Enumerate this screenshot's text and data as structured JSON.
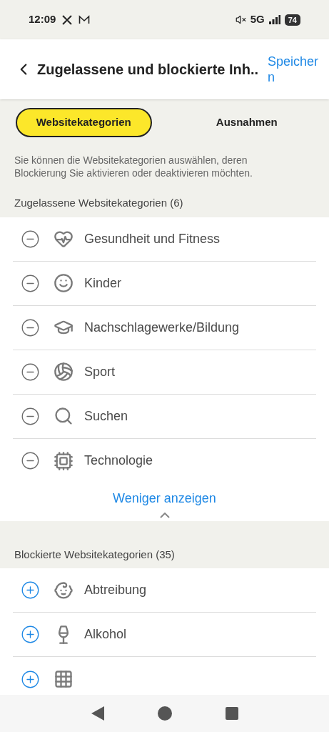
{
  "status_bar": {
    "time": "12:09",
    "network": "5G",
    "battery": "74"
  },
  "header": {
    "title": "Zugelassene und blockierte Inh..",
    "save": "Speichern"
  },
  "tabs": [
    {
      "label": "Websitekategorien",
      "selected": true
    },
    {
      "label": "Ausnahmen",
      "selected": false
    }
  ],
  "description": "Sie können die Websitekategorien auswählen, deren Blockierung Sie aktivieren oder deaktivieren möchten.",
  "allowed": {
    "heading": "Zugelassene Websitekategorien (6)",
    "items": [
      {
        "label": "Gesundheit und Fitness",
        "kind": "health"
      },
      {
        "label": "Kinder",
        "kind": "kids"
      },
      {
        "label": "Nachschlagewerke/Bildung",
        "kind": "education"
      },
      {
        "label": "Sport",
        "kind": "sport"
      },
      {
        "label": "Suchen",
        "kind": "search"
      },
      {
        "label": "Technologie",
        "kind": "tech"
      }
    ],
    "toggle": "Weniger anzeigen"
  },
  "blocked": {
    "heading": "Blockierte Websitekategorien (35)",
    "items": [
      {
        "label": "Abtreibung",
        "kind": "baby"
      },
      {
        "label": "Alkohol",
        "kind": "wine"
      },
      {
        "kind": "grid"
      }
    ]
  }
}
